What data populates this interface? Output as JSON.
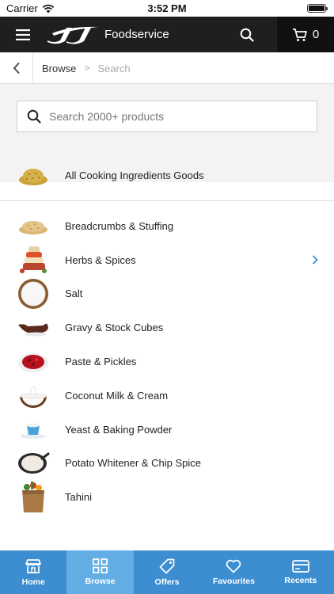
{
  "status_bar": {
    "carrier": "Carrier",
    "time": "3:52 PM"
  },
  "header": {
    "brand": "Foodservice",
    "cart_count": "0"
  },
  "breadcrumb": {
    "browse": "Browse",
    "separator": ">",
    "current": "Search"
  },
  "search": {
    "placeholder": "Search 2000+ products",
    "value": ""
  },
  "all_item": {
    "label": "All Cooking Ingredients Goods",
    "icon": "spice-powder"
  },
  "categories": [
    {
      "label": "Breadcrumbs & Stuffing",
      "icon": "breadcrumbs",
      "has_children": false
    },
    {
      "label": "Herbs & Spices",
      "icon": "spice-jars",
      "has_children": true
    },
    {
      "label": "Salt",
      "icon": "salt-bowl",
      "has_children": false
    },
    {
      "label": "Gravy & Stock Cubes",
      "icon": "gravy-boat",
      "has_children": false
    },
    {
      "label": "Paste & Pickles",
      "icon": "pickles-dish",
      "has_children": false
    },
    {
      "label": "Coconut Milk & Cream",
      "icon": "coconut",
      "has_children": false
    },
    {
      "label": "Yeast & Baking Powder",
      "icon": "baking-powder",
      "has_children": false
    },
    {
      "label": "Potato Whitener & Chip Spice",
      "icon": "white-powder-scoop",
      "has_children": false
    },
    {
      "label": "Tahini",
      "icon": "grocery-bag",
      "has_children": false
    }
  ],
  "tabs": [
    {
      "label": "Home",
      "icon": "store-icon",
      "active": false
    },
    {
      "label": "Browse",
      "icon": "grid-icon",
      "active": true
    },
    {
      "label": "Offers",
      "icon": "tag-icon",
      "active": false
    },
    {
      "label": "Favourites",
      "icon": "heart-icon",
      "active": false
    },
    {
      "label": "Recents",
      "icon": "card-icon",
      "active": false
    }
  ],
  "colors": {
    "header_bg": "#1f1f1f",
    "cart_bg": "#111111",
    "tabbar_bg": "#3d8ed0",
    "tab_active_bg": "#62aee4",
    "accent": "#3d8ed0"
  }
}
